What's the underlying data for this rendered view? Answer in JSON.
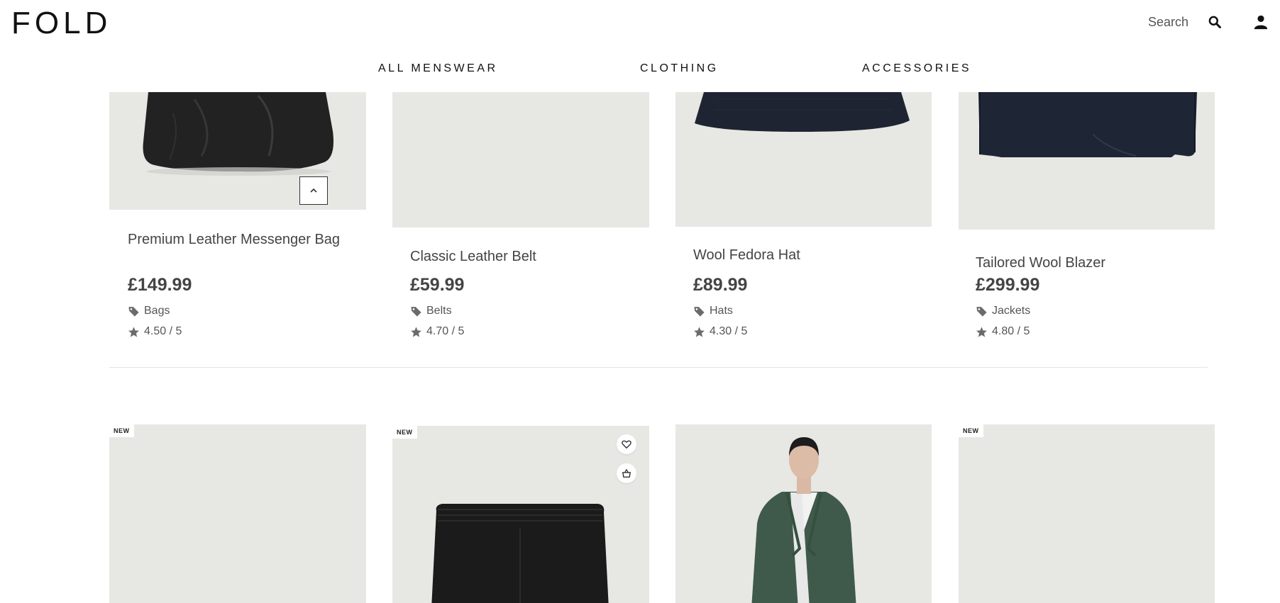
{
  "header": {
    "logo": "FOLD",
    "search_label": "Search",
    "nav": [
      "ALL MENSWEAR",
      "CLOTHING",
      "ACCESSORIES"
    ]
  },
  "products_row1": [
    {
      "name": "Premium Leather Messenger Bag",
      "price": "£149.99",
      "category": "Bags",
      "rating": "4.50 / 5"
    },
    {
      "name": "Classic Leather Belt",
      "price": "£59.99",
      "category": "Belts",
      "rating": "4.70 / 5"
    },
    {
      "name": "Wool Fedora Hat",
      "price": "£89.99",
      "category": "Hats",
      "rating": "4.30 / 5"
    },
    {
      "name": "Tailored Wool Blazer",
      "price": "£299.99",
      "category": "Jackets",
      "rating": "4.80 / 5"
    }
  ],
  "products_row2": [
    {
      "badge": "NEW"
    },
    {
      "badge": "NEW"
    },
    {},
    {
      "badge": "NEW"
    }
  ],
  "colors": {
    "accent": "#111111",
    "image_bg": "#e7e7e4",
    "text_muted": "#555555"
  },
  "icons": {
    "search": "search-icon",
    "user": "user-icon",
    "tag": "tag-icon",
    "star": "star-icon",
    "wishlist": "heart-icon",
    "basket": "basket-icon",
    "scroll_top": "chevron-up-icon"
  }
}
